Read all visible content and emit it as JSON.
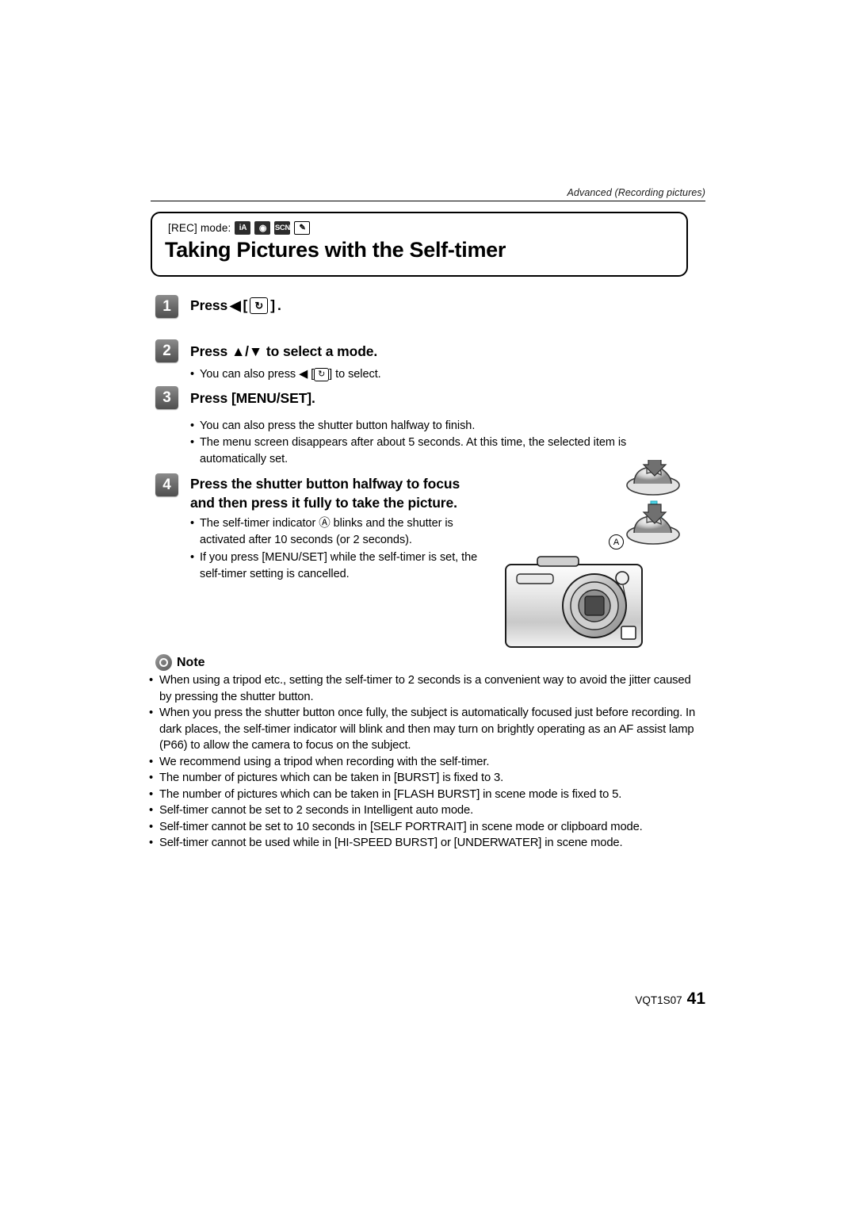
{
  "header": {
    "running_head": "Advanced (Recording pictures)"
  },
  "title_block": {
    "rec_mode_label": "[REC] mode:",
    "mode_icons": [
      "iA",
      "◉",
      "SCN",
      "✎"
    ],
    "title": "Taking Pictures with the Self-timer"
  },
  "steps": [
    {
      "num": "1",
      "title_pre": "Press",
      "title_arrow": "◀",
      "title_glyph": "↻",
      "title_post": ".",
      "bullets": []
    },
    {
      "num": "2",
      "title": "Press ▲/▼ to select a mode.",
      "bullets": [
        {
          "pre": "You can also press",
          "arrow": "◀",
          "glyph": "↻",
          "post": "to select."
        }
      ]
    },
    {
      "num": "3",
      "title": "Press [MENU/SET].",
      "bullets": [
        "You can also press the shutter button halfway to finish.",
        "The menu screen disappears after about 5 seconds. At this time, the selected item is automatically set."
      ]
    },
    {
      "num": "4",
      "title_line1": "Press the shutter button halfway to focus",
      "title_line2": "and then press it fully to take the picture.",
      "bullets": [
        "The self-timer indicator Ⓐ blinks and the shutter is activated after 10 seconds (or 2 seconds).",
        "If you press [MENU/SET] while the self-timer is set, the self-timer setting is cancelled."
      ]
    }
  ],
  "note": {
    "label": "Note",
    "items": [
      "When using a tripod etc., setting the self-timer to 2 seconds is a convenient way to avoid the jitter caused by pressing the shutter button.",
      "When you press the shutter button once fully, the subject is automatically focused just before recording. In dark places, the self-timer indicator will blink and then may turn on brightly operating as an AF assist lamp (P66) to allow the camera to focus on the subject.",
      "We recommend using a tripod when recording with the self-timer.",
      "The number of pictures which can be taken in [BURST] is fixed to 3.",
      "The number of pictures which can be taken in [FLASH BURST] in scene mode is fixed to 5.",
      "Self-timer cannot be set to 2 seconds in Intelligent auto mode.",
      "Self-timer cannot be set to 10 seconds in [SELF PORTRAIT] in scene mode or clipboard mode.",
      "Self-timer cannot be used while in [HI-SPEED BURST] or [UNDERWATER] in scene mode."
    ]
  },
  "illustration": {
    "callout_a": "Ⓐ",
    "arrow_color": "#4ad4e8"
  },
  "footer": {
    "code": "VQT1S07",
    "page": "41"
  }
}
